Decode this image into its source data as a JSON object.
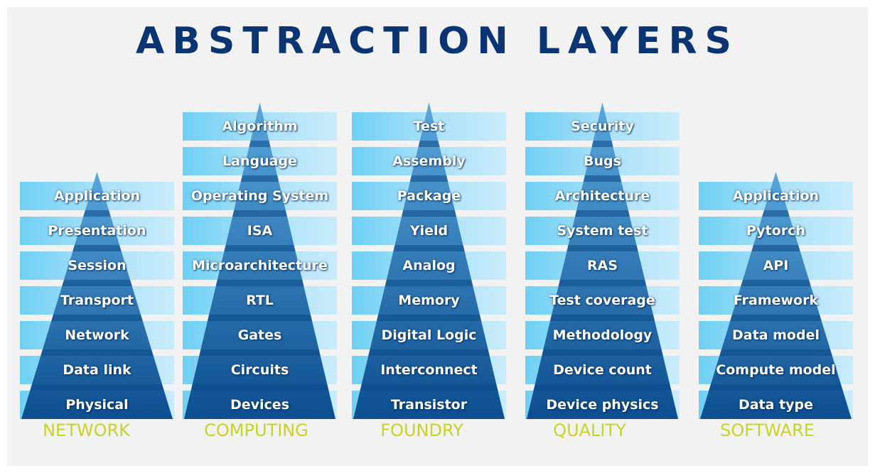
{
  "title": "ABSTRACTION LAYERS",
  "colors": {
    "title": "#0b3572",
    "category_label": "#c6d424",
    "band_light": "#6fd0f4",
    "band_lighter": "#c8ecfb",
    "pyramid_top": "#5aa7dc",
    "pyramid_bottom": "#0c4e90",
    "layer_text": "#ffffff"
  },
  "stacks": [
    {
      "name": "NETWORK",
      "layers": [
        "Application",
        "Presentation",
        "Session",
        "Transport",
        "Network",
        "Data link",
        "Physical"
      ]
    },
    {
      "name": "COMPUTING",
      "layers": [
        "Algorithm",
        "Language",
        "Operating System",
        "ISA",
        "Microarchitecture",
        "RTL",
        "Gates",
        "Circuits",
        "Devices"
      ]
    },
    {
      "name": "FOUNDRY",
      "layers": [
        "Test",
        "Assembly",
        "Package",
        "Yield",
        "Analog",
        "Memory",
        "Digital Logic",
        "Interconnect",
        "Transistor"
      ]
    },
    {
      "name": "QUALITY",
      "layers": [
        "Security",
        "Bugs",
        "Architecture",
        "System test",
        "RAS",
        "Test coverage",
        "Methodology",
        "Device count",
        "Device physics"
      ]
    },
    {
      "name": "SOFTWARE",
      "layers": [
        "Application",
        "Pytorch",
        "API",
        "Framework",
        "Data model",
        "Compute model",
        "Data type"
      ]
    }
  ]
}
